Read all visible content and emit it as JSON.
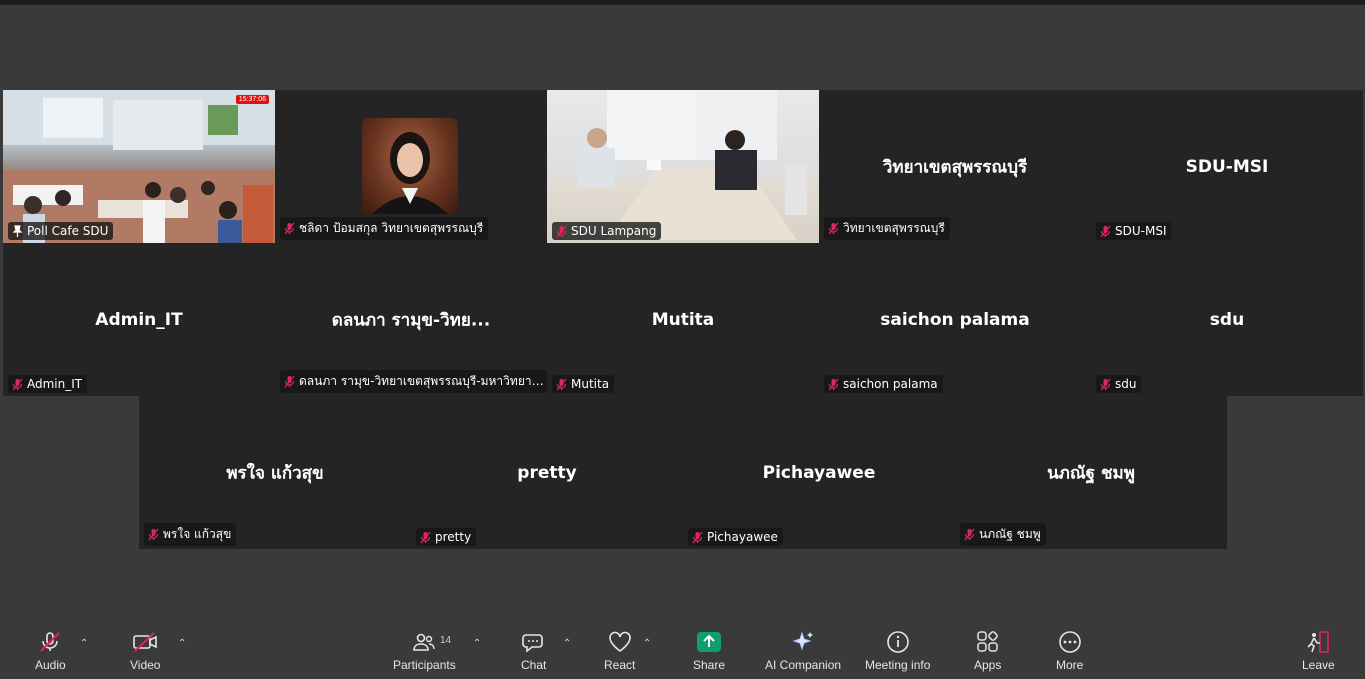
{
  "tiles": [
    {
      "label": "Poll Cafe SDU",
      "big": "",
      "icon": "pin"
    },
    {
      "label": "ชลิดา  ป้อมสกุล วิทยาเขตสุพรรณบุรี",
      "big": "",
      "icon": "mute"
    },
    {
      "label": "SDU Lampang",
      "big": "",
      "icon": "mute"
    },
    {
      "label": "วิทยาเขตสุพรรณบุรี",
      "big": "วิทยาเขตสุพรรณบุรี",
      "icon": "mute"
    },
    {
      "label": "SDU-MSI",
      "big": "SDU-MSI",
      "icon": "mute"
    },
    {
      "label": "Admin_IT",
      "big": "Admin_IT",
      "icon": "mute"
    },
    {
      "label": "ดลนภา รามุข-วิทยาเขตสุพรรณบุรี-มหาวิทยาลัย...",
      "big": "ดลนภา รามุข-วิทย...",
      "icon": "mute"
    },
    {
      "label": "Mutita",
      "big": "Mutita",
      "icon": "mute"
    },
    {
      "label": "saichon palama",
      "big": "saichon palama",
      "icon": "mute"
    },
    {
      "label": "sdu",
      "big": "sdu",
      "icon": "mute"
    },
    {
      "label": "พรใจ  แก้วสุข",
      "big": "พรใจ  แก้วสุข",
      "icon": "mute"
    },
    {
      "label": "pretty",
      "big": "pretty",
      "icon": "mute"
    },
    {
      "label": "Pichayawee",
      "big": "Pichayawee",
      "icon": "mute"
    },
    {
      "label": "นภณัฐ ชมพู",
      "big": "นภณัฐ ชมพู",
      "icon": "mute"
    }
  ],
  "recording_badge": "15:37:06",
  "toolbar": {
    "audio": "Audio",
    "video": "Video",
    "participants": "Participants",
    "participants_count": "14",
    "chat": "Chat",
    "react": "React",
    "share": "Share",
    "ai_companion": "AI Companion",
    "meeting_info": "Meeting info",
    "apps": "Apps",
    "more": "More",
    "leave": "Leave"
  },
  "colors": {
    "background": "#3a3a3a",
    "tile": "#242424",
    "active_speaker": "#2ecc71",
    "mute_red": "#e0245e",
    "share_green": "#0e9f6e",
    "leave_red": "#e0245e"
  }
}
